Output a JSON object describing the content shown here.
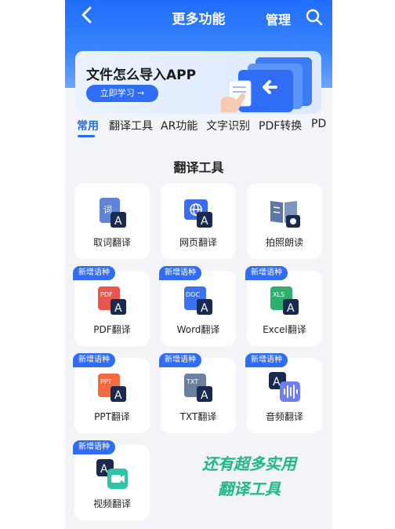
{
  "header": {
    "title": "更多功能",
    "manage_label": "管理"
  },
  "banner": {
    "title": "文件怎么导入APP",
    "button_label": "立即学习 →"
  },
  "tabs": [
    {
      "label": "常用"
    },
    {
      "label": "翻译工具"
    },
    {
      "label": "AR功能"
    },
    {
      "label": "文字识别"
    },
    {
      "label": "PDF转换"
    },
    {
      "label": "PD"
    }
  ],
  "section": {
    "title": "翻译工具"
  },
  "badge_text": "新增语种",
  "tools": [
    {
      "label": "取词翻译",
      "icon_text": "词",
      "badge": false
    },
    {
      "label": "网页翻译",
      "icon_text": "",
      "badge": false
    },
    {
      "label": "拍照朗读",
      "icon_text": "",
      "badge": false
    },
    {
      "label": "PDF翻译",
      "icon_text": "PDF",
      "badge": true
    },
    {
      "label": "Word翻译",
      "icon_text": "DOC",
      "badge": true
    },
    {
      "label": "Excel翻译",
      "icon_text": "XLS",
      "badge": true
    },
    {
      "label": "PPT翻译",
      "icon_text": "PPT",
      "badge": true
    },
    {
      "label": "TXT翻译",
      "icon_text": "TXT",
      "badge": true
    },
    {
      "label": "音频翻译",
      "icon_text": "",
      "badge": true
    },
    {
      "label": "视频翻译",
      "icon_text": "",
      "badge": true
    }
  ],
  "promo": {
    "line1": "还有超多实用",
    "line2": "翻译工具"
  },
  "colors": {
    "primary": "#1f6dfb",
    "promo": "#25b58a"
  }
}
